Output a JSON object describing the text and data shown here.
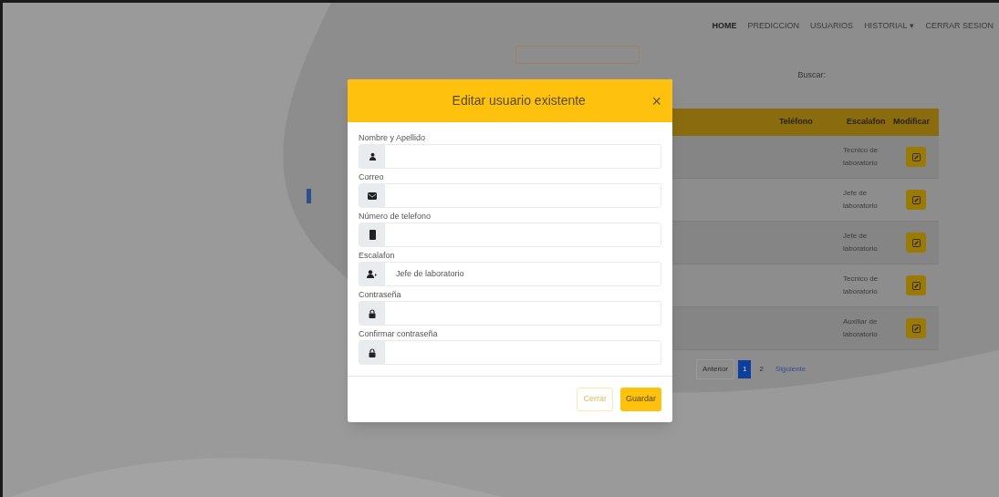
{
  "nav": [
    {
      "label": "HOME",
      "selected": true
    },
    {
      "label": "PREDICCION",
      "selected": false
    },
    {
      "label": "USUARIOS",
      "selected": false
    },
    {
      "label": "HISTORIAL",
      "selected": false,
      "caret": "▾"
    },
    {
      "label": "CERRAR SESION",
      "selected": false
    }
  ],
  "search": {
    "label": "Buscar:"
  },
  "table": {
    "columns": [
      "Teléfono",
      "Escalafon",
      "Modificar"
    ],
    "rows": [
      {
        "escalafon": "Tecnico de laboratorio"
      },
      {
        "escalafon": "Jefe de laboratorio"
      },
      {
        "escalafon": "Jefe de laboratorio"
      },
      {
        "escalafon": "Tecnico de laboratorio"
      },
      {
        "escalafon": "Auxiliar de laboratorio"
      }
    ]
  },
  "pagination": {
    "previous": "Anterior",
    "pages": [
      {
        "label": "1",
        "selected": true
      },
      {
        "label": "2",
        "selected": false
      }
    ],
    "next": "Siguiente"
  },
  "modal": {
    "title": "Editar usuario existente",
    "close": "×",
    "fields": [
      {
        "kind": "name",
        "label": "Nombre y Apellido"
      },
      {
        "kind": "email",
        "label": "Correo"
      },
      {
        "kind": "phone",
        "label": "Número de telefono"
      },
      {
        "kind": "rank",
        "label": "Escalafon",
        "value": "Jefe de laboratorio"
      },
      {
        "kind": "password",
        "label": "Contraseña"
      },
      {
        "kind": "password",
        "label": "Confirmar contraseña"
      }
    ],
    "buttons": [
      {
        "kind": "secondary",
        "label": "Cerrar"
      },
      {
        "kind": "primary",
        "label": "Guardar"
      }
    ]
  }
}
